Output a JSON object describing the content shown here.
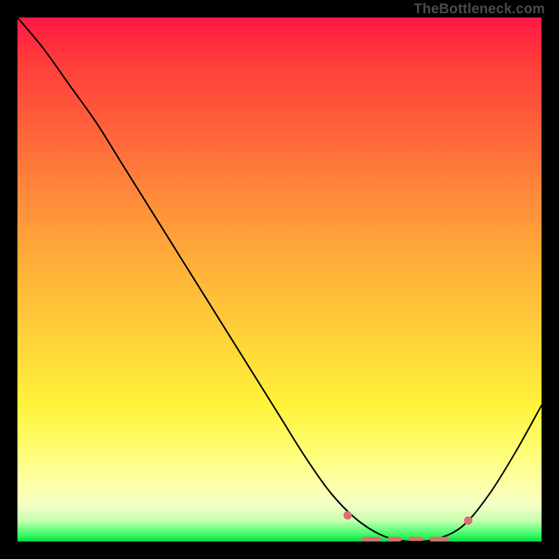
{
  "attribution": "TheBottleneck.com",
  "chart_data": {
    "type": "line",
    "title": "",
    "xlabel": "",
    "ylabel": "",
    "xlim": [
      0,
      100
    ],
    "ylim": [
      0,
      100
    ],
    "curve": [
      {
        "x": 0,
        "y": 100
      },
      {
        "x": 5,
        "y": 94
      },
      {
        "x": 10,
        "y": 87
      },
      {
        "x": 15,
        "y": 80
      },
      {
        "x": 20,
        "y": 72
      },
      {
        "x": 25,
        "y": 64
      },
      {
        "x": 30,
        "y": 56
      },
      {
        "x": 35,
        "y": 48
      },
      {
        "x": 40,
        "y": 40
      },
      {
        "x": 45,
        "y": 32
      },
      {
        "x": 50,
        "y": 24
      },
      {
        "x": 55,
        "y": 16
      },
      {
        "x": 60,
        "y": 9
      },
      {
        "x": 65,
        "y": 4
      },
      {
        "x": 70,
        "y": 1
      },
      {
        "x": 75,
        "y": 0
      },
      {
        "x": 80,
        "y": 0.5
      },
      {
        "x": 85,
        "y": 3
      },
      {
        "x": 90,
        "y": 9
      },
      {
        "x": 95,
        "y": 17
      },
      {
        "x": 100,
        "y": 26
      }
    ],
    "annotations": {
      "marker_dots": [
        {
          "x": 63,
          "y": 5
        },
        {
          "x": 86,
          "y": 4
        }
      ],
      "marker_dashes_y": 0.5,
      "marker_dash_segments": [
        {
          "x1": 66,
          "x2": 69
        },
        {
          "x1": 71,
          "x2": 73
        },
        {
          "x1": 75,
          "x2": 77
        },
        {
          "x1": 79,
          "x2": 82
        }
      ]
    }
  }
}
